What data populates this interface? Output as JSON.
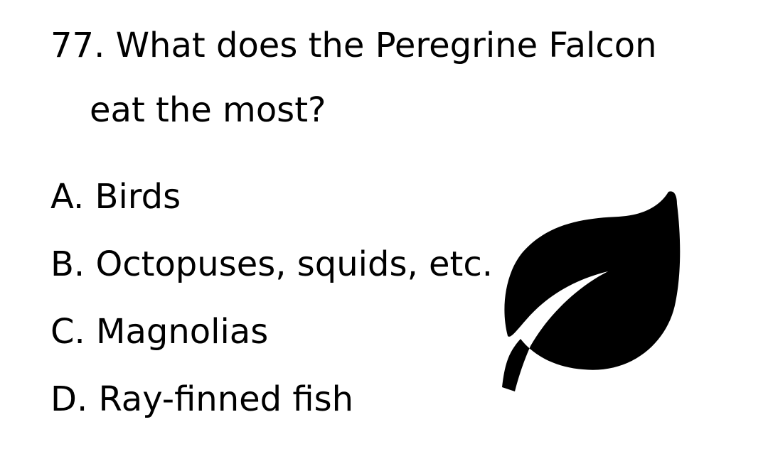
{
  "question": {
    "line1": "77. What does the Peregrine Falcon",
    "line2": "eat the most?"
  },
  "options": [
    {
      "label": "A. Birds"
    },
    {
      "label": "B. Octopuses, squids, etc."
    },
    {
      "label": "C. Magnolias"
    },
    {
      "label": "D. Ray-finned fish"
    }
  ],
  "illustration": {
    "icon": "leaf-icon",
    "color": "#000000"
  }
}
